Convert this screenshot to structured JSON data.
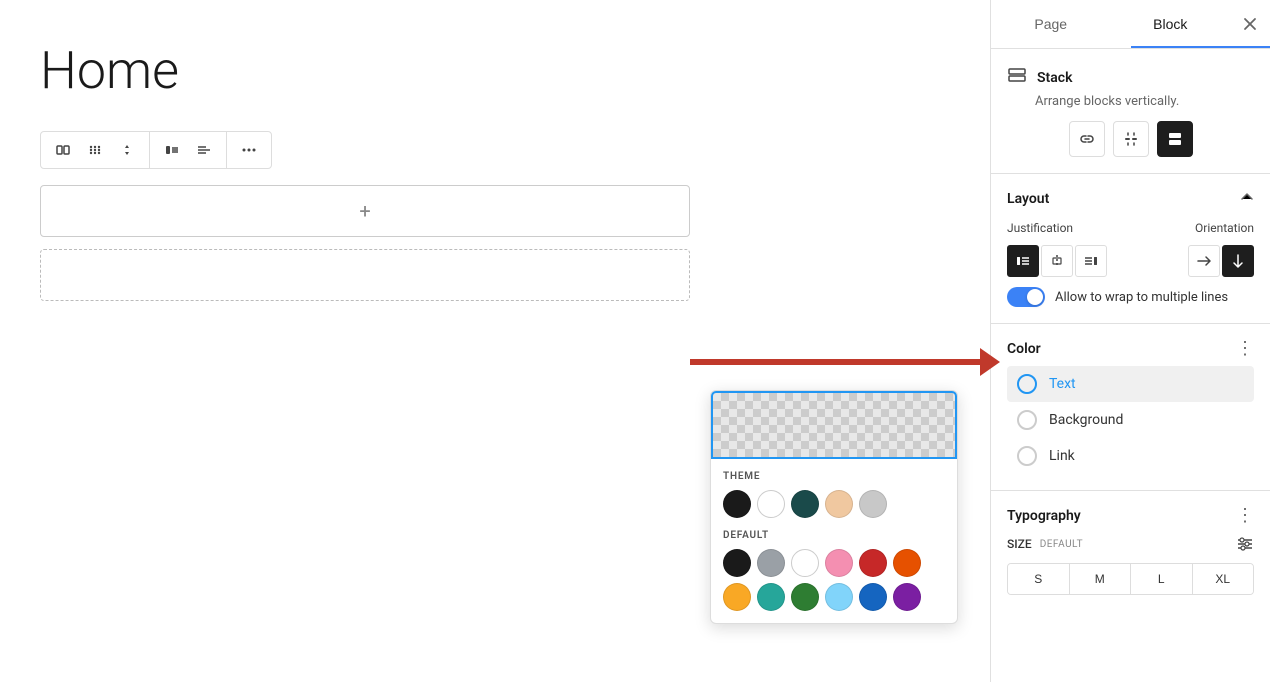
{
  "sidebar": {
    "tabs": [
      {
        "label": "Page",
        "active": false
      },
      {
        "label": "Block",
        "active": true
      }
    ],
    "close_btn": "✕",
    "stack": {
      "title": "Stack",
      "desc": "Arrange blocks vertically.",
      "controls": [
        {
          "icon": "link",
          "active": false
        },
        {
          "icon": "unlink",
          "active": false
        },
        {
          "icon": "stack-active",
          "active": true
        }
      ]
    },
    "layout": {
      "title": "Layout",
      "justification_label": "Justification",
      "orientation_label": "Orientation",
      "justify_btns": [
        {
          "icon": "justify-left",
          "active": true
        },
        {
          "icon": "justify-center",
          "active": false
        },
        {
          "icon": "justify-right",
          "active": false
        }
      ],
      "orient_btns": [
        {
          "icon": "orient-horiz",
          "active": false
        },
        {
          "icon": "orient-vert",
          "active": true
        }
      ],
      "wrap_label": "Allow to wrap to multiple lines",
      "wrap_on": true
    },
    "color": {
      "title": "Color",
      "options": [
        {
          "label": "Text",
          "active": true
        },
        {
          "label": "Background",
          "active": false
        },
        {
          "label": "Link",
          "active": false
        }
      ]
    },
    "typography": {
      "title": "Typography",
      "size_label": "SIZE",
      "size_default": "DEFAULT",
      "size_btns": [
        "S",
        "M",
        "L",
        "XL"
      ]
    }
  },
  "canvas": {
    "page_title": "Home",
    "add_btn_icon": "+",
    "toolbar": {
      "groups": [
        {
          "btns": [
            {
              "icon": "⊞",
              "active": false
            },
            {
              "icon": "⋮⋮",
              "active": false
            },
            {
              "icon": "▲",
              "active": false
            }
          ]
        },
        {
          "btns": [
            {
              "icon": "◧",
              "active": false
            },
            {
              "icon": "≡",
              "active": false
            }
          ]
        },
        {
          "btns": [
            {
              "icon": "⋯",
              "active": false
            }
          ]
        }
      ]
    }
  },
  "color_popup": {
    "theme_label": "THEME",
    "default_label": "DEFAULT",
    "theme_colors": [
      {
        "class": "black",
        "label": "Black"
      },
      {
        "class": "white",
        "label": "White"
      },
      {
        "class": "teal",
        "label": "Dark Teal"
      },
      {
        "class": "peach",
        "label": "Peach"
      },
      {
        "class": "gray",
        "label": "Gray"
      }
    ],
    "default_colors": [
      {
        "class": "d-black",
        "label": "Black"
      },
      {
        "class": "d-gray",
        "label": "Gray"
      },
      {
        "class": "d-white",
        "label": "White"
      },
      {
        "class": "d-pink",
        "label": "Pink"
      },
      {
        "class": "d-red",
        "label": "Red"
      },
      {
        "class": "d-orange",
        "label": "Orange"
      },
      {
        "class": "d-yellow",
        "label": "Yellow"
      },
      {
        "class": "d-teal",
        "label": "Teal"
      },
      {
        "class": "d-green",
        "label": "Green"
      },
      {
        "class": "d-lblue",
        "label": "Light Blue"
      },
      {
        "class": "d-blue",
        "label": "Blue"
      },
      {
        "class": "d-purple",
        "label": "Purple"
      }
    ]
  }
}
